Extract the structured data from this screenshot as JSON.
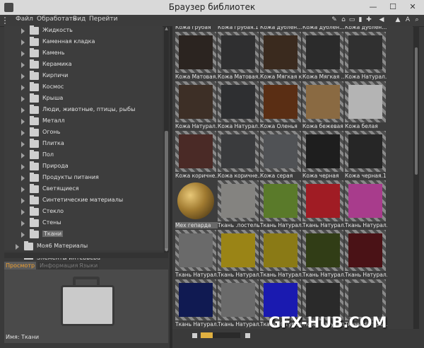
{
  "window": {
    "title": "Браузер библиотек",
    "minimize": "—",
    "maximize": "☐",
    "close": "✕"
  },
  "menu": [
    "Файл",
    "Обработать",
    "Вид",
    "Перейти"
  ],
  "tree": {
    "items": [
      {
        "label": "Жидкость"
      },
      {
        "label": "Каменная кладка"
      },
      {
        "label": "Камень"
      },
      {
        "label": "Керамика"
      },
      {
        "label": "Кирпичи"
      },
      {
        "label": "Космос"
      },
      {
        "label": "Крыша"
      },
      {
        "label": "Люди, животные, птицы, рыбы"
      },
      {
        "label": "Металл"
      },
      {
        "label": "Огонь"
      },
      {
        "label": "Плитка"
      },
      {
        "label": "Пол"
      },
      {
        "label": "Природа"
      },
      {
        "label": "Продукты питания"
      },
      {
        "label": "Светящиеся"
      },
      {
        "label": "Синтетические материалы"
      },
      {
        "label": "Стекло"
      },
      {
        "label": "Стены"
      },
      {
        "label": "Ткани",
        "selected": true
      }
    ],
    "parent": {
      "label": "Moя6   Материалы"
    },
    "cut_off": {
      "label": "Элементы интерьера"
    }
  },
  "tabs": [
    {
      "label": "Просмотр",
      "active": true
    },
    {
      "label": "Информация",
      "active": false
    },
    {
      "label": "Языки",
      "active": false
    }
  ],
  "preview": {
    "name": "Имя: Ткани"
  },
  "grid": {
    "top_captions": [
      "Кожа грубая",
      "Кожа грубая.1",
      "Кожа дублен...",
      "Кожа дублен...",
      "Кожа дублен..."
    ],
    "rows": [
      [
        {
          "caption": "Кожа Матовая...",
          "color": "#2b2420"
        },
        {
          "caption": "Кожа Матовая...",
          "color": "#2f2f30"
        },
        {
          "caption": "Кожа Мягкая к...",
          "color": "#3a2a1e"
        },
        {
          "caption": "Кожа Мягкая ...",
          "color": "#2b2b2b"
        },
        {
          "caption": "Кожа Натурал...",
          "color": "#303030"
        }
      ],
      [
        {
          "caption": "Кожа Натурал...",
          "color": "#3d2f26"
        },
        {
          "caption": "Кожа Натурал...",
          "color": "#2e2f31"
        },
        {
          "caption": "Кожа Оленья",
          "color": "#5a2e14"
        },
        {
          "caption": "Кожа бежевая",
          "color": "#8a6a42"
        },
        {
          "caption": "Кожа белая",
          "color": "#b4b4b4"
        }
      ],
      [
        {
          "caption": "Кожа коричне...",
          "color": "#4a2a26"
        },
        {
          "caption": "Кожа коричне...",
          "color": "#3a3b3d"
        },
        {
          "caption": "Кожа серая",
          "color": "#505255"
        },
        {
          "caption": "Кожа черная",
          "color": "#1e1e1e"
        },
        {
          "caption": "Кожа черная.1",
          "color": "#262626"
        }
      ],
      [
        {
          "caption": "Мех гепарда",
          "color": "leopard",
          "selected": true
        },
        {
          "caption": "Ткань .постель...",
          "color": "#848380"
        },
        {
          "caption": "Ткань Натурал...",
          "color": "#5a7a2a"
        },
        {
          "caption": "Ткань Натурал...",
          "color": "#a01c24"
        },
        {
          "caption": "Ткань Натурал...",
          "color": "#a83c8c"
        }
      ],
      [
        {
          "caption": "Ткань Натурал...",
          "color": "#6a6a6a"
        },
        {
          "caption": "Ткань Натурал...",
          "color": "#9a8416"
        },
        {
          "caption": "Ткань Натурал...",
          "color": "#8a7a16"
        },
        {
          "caption": "Ткань Натурал...",
          "color": "#313d16"
        },
        {
          "caption": "Ткань Натурал...",
          "color": "#4a1216"
        }
      ],
      [
        {
          "caption": "Ткань Натурал...",
          "color": "#101a52"
        },
        {
          "caption": "Ткань Натурал...",
          "color": "#6a6a6a"
        },
        {
          "caption": "Ткань Натурал...",
          "color": "#1a1ab0"
        },
        {
          "caption": "Ткань Натурал...",
          "color": "#2a2a2a"
        },
        {
          "caption": "Ткань Натурал...",
          "color": "#3a3a3a"
        }
      ]
    ]
  },
  "status": {
    "zoom_fraction": 0.3
  },
  "watermark": "GFX-HUB.COM"
}
